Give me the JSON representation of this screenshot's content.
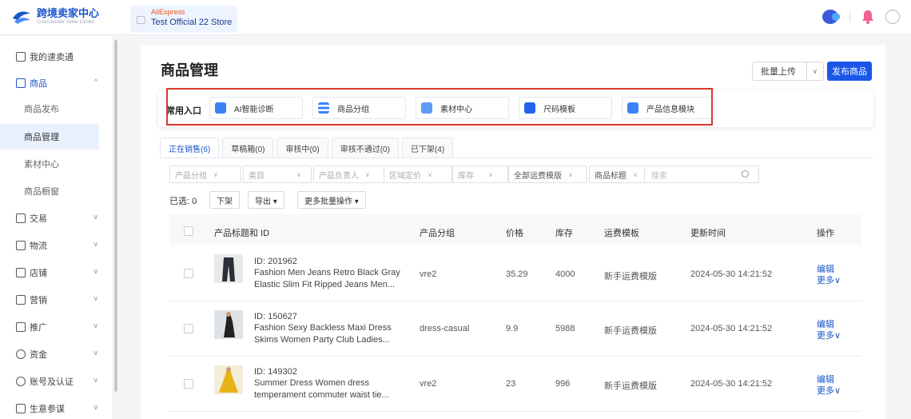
{
  "header": {
    "logo_title": "跨境卖家中心",
    "logo_sub": "Cross-border Seller Center",
    "store_brand": "AliExpress",
    "store_name": "Test Official 22 Store",
    "icons": [
      "chat-icon",
      "bell-icon",
      "avatar-icon"
    ]
  },
  "sidebar": {
    "items": [
      {
        "label": "我的速卖通",
        "icon": "home-icon"
      },
      {
        "label": "商品",
        "icon": "product-icon",
        "chevron": "^"
      },
      {
        "label": "商品发布"
      },
      {
        "label": "商品管理"
      },
      {
        "label": "素材中心"
      },
      {
        "label": "商品橱窗"
      },
      {
        "label": "交易",
        "icon": "trade-icon",
        "chevron": "v"
      },
      {
        "label": "物流",
        "icon": "logistics-icon",
        "chevron": "v"
      },
      {
        "label": "店铺",
        "icon": "store-icon",
        "chevron": "v"
      },
      {
        "label": "营销",
        "icon": "marketing-icon",
        "chevron": "v"
      },
      {
        "label": "推广",
        "icon": "promotion-icon",
        "chevron": "v"
      },
      {
        "label": "资金",
        "icon": "funds-icon",
        "chevron": "v"
      },
      {
        "label": "账号及认证",
        "icon": "account-icon",
        "chevron": "v"
      },
      {
        "label": "生意参谋",
        "icon": "analytics-icon",
        "chevron": "v"
      }
    ]
  },
  "page": {
    "title": "商品管理",
    "bulk_upload": "批量上传",
    "publish": "发布商品"
  },
  "quick": {
    "label": "常用入口",
    "buttons": [
      "AI智能诊断",
      "商品分组",
      "素材中心",
      "尺码模板",
      "产品信息模块"
    ]
  },
  "tabs": [
    "正在销售(6)",
    "草稿箱(0)",
    "审核中(0)",
    "审核不通过(0)",
    "已下架(4)"
  ],
  "filters": {
    "items": [
      "产品分组",
      "类目",
      "产品负责人",
      "区域定价",
      "库存",
      "全部运费模版",
      "商品标题"
    ],
    "search_placeholder": "搜索"
  },
  "selection": {
    "selected": "已选: 0",
    "offshelf": "下架",
    "export": "导出 ▾",
    "more_bulk": "更多批量操作 ▾"
  },
  "table": {
    "headers": [
      "产品标题和 ID",
      "产品分组",
      "价格",
      "库存",
      "运费模板",
      "更新时间",
      "操作"
    ],
    "rows": [
      {
        "id": "ID: 201962",
        "title1": "Fashion Men Jeans Retro Black Gray",
        "title2": "Elastic Slim Fit Ripped Jeans Men...",
        "group": "vre2",
        "price": "35.29",
        "stock": "4000",
        "shipping": "新手运费模版",
        "updated": "2024-05-30 14:21:52",
        "edit": "编辑",
        "more": "更多∨"
      },
      {
        "id": "ID: 150627",
        "title1": "Fashion Sexy Backless Maxi Dress",
        "title2": "Skims Women Party Club Ladies...",
        "group": "dress-casual",
        "price": "9.9",
        "stock": "5988",
        "shipping": "新手运费模版",
        "updated": "2024-05-30 14:21:52",
        "edit": "编辑",
        "more": "更多∨"
      },
      {
        "id": "ID: 149302",
        "title1": "Summer Dress Women dress",
        "title2": "temperament commuter waist tie...",
        "group": "vre2",
        "price": "23",
        "stock": "996",
        "shipping": "新手运费模版",
        "updated": "2024-05-30 14:21:52",
        "edit": "编辑",
        "more": "更多∨"
      }
    ]
  },
  "colors": {
    "accent": "#1a56e8",
    "highlight": "#d63a2f",
    "link": "#1a56c9"
  }
}
